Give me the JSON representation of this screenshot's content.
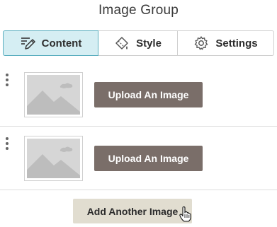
{
  "panel": {
    "title": "Image Group"
  },
  "tabs": [
    {
      "label": "Content",
      "icon": "pencil-lines-icon",
      "active": true
    },
    {
      "label": "Style",
      "icon": "paint-bucket-icon",
      "active": false
    },
    {
      "label": "Settings",
      "icon": "gear-icon",
      "active": false
    }
  ],
  "images": [
    {
      "placeholder_icon": "image-placeholder-icon",
      "upload_label": "Upload An Image"
    },
    {
      "placeholder_icon": "image-placeholder-icon",
      "upload_label": "Upload An Image"
    }
  ],
  "add_button": {
    "label": "Add Another Image"
  },
  "colors": {
    "active_tab_bg": "#d5eef3",
    "active_tab_border": "#5aaebf",
    "upload_button_bg": "#7a6e69",
    "add_button_bg": "#e1ddd0"
  }
}
